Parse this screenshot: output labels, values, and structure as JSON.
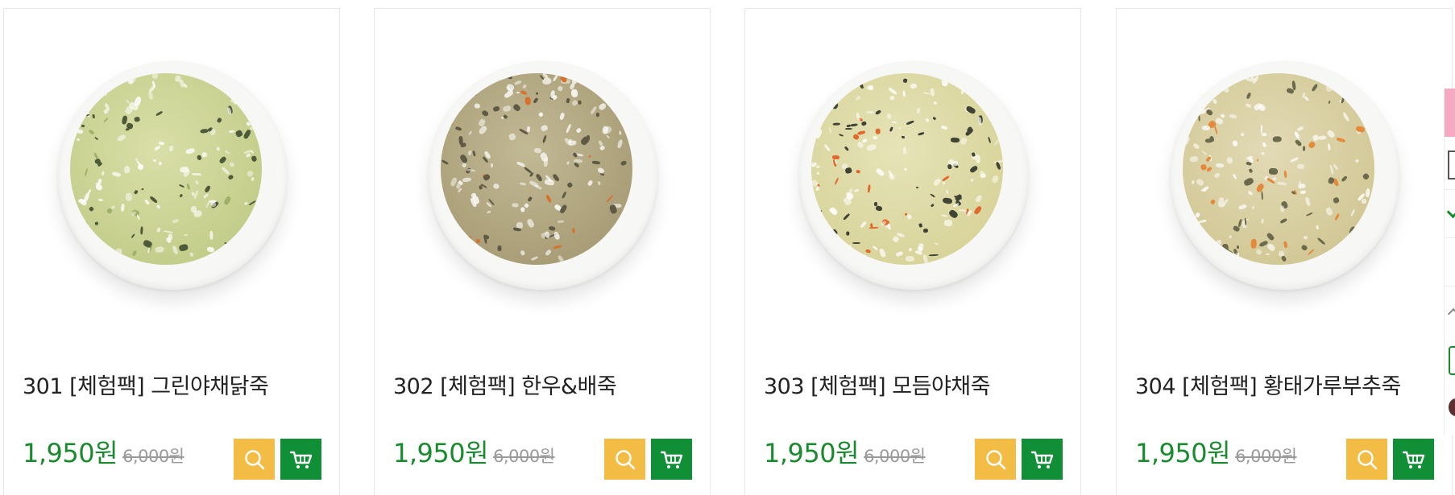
{
  "products": [
    {
      "name": "301 [체험팩] 그린야채닭죽",
      "price": "1,950원",
      "original_price": "6,000원",
      "colors": {
        "base": "#c3cd8a",
        "light": "#d9dfa8",
        "speck_dark": "#4d5a3a",
        "speck_accent": "#9fb168"
      }
    },
    {
      "name": "302 [체험팩] 한우&배죽",
      "price": "1,950원",
      "original_price": "6,000원",
      "colors": {
        "base": "#a89d76",
        "light": "#c2b995",
        "speck_dark": "#5e5a45",
        "speck_accent": "#d9702b"
      }
    },
    {
      "name": "303 [체험팩] 모듬야채죽",
      "price": "1,950원",
      "original_price": "6,000원",
      "colors": {
        "base": "#d8d49a",
        "light": "#e6e3b8",
        "speck_dark": "#3f4436",
        "speck_accent": "#e06a2c"
      }
    },
    {
      "name": "304 [체험팩] 황태가루부추죽",
      "price": "1,950원",
      "original_price": "6,000원",
      "colors": {
        "base": "#d2c896",
        "light": "#e2dab5",
        "speck_dark": "#6b6a4c",
        "speck_accent": "#e48a3a"
      }
    }
  ],
  "icons": {
    "view": "magnifier-icon",
    "cart": "cart-icon"
  },
  "colors": {
    "price": "#1a8a2e",
    "view_button": "#f3bd45",
    "cart_button": "#118f36"
  }
}
